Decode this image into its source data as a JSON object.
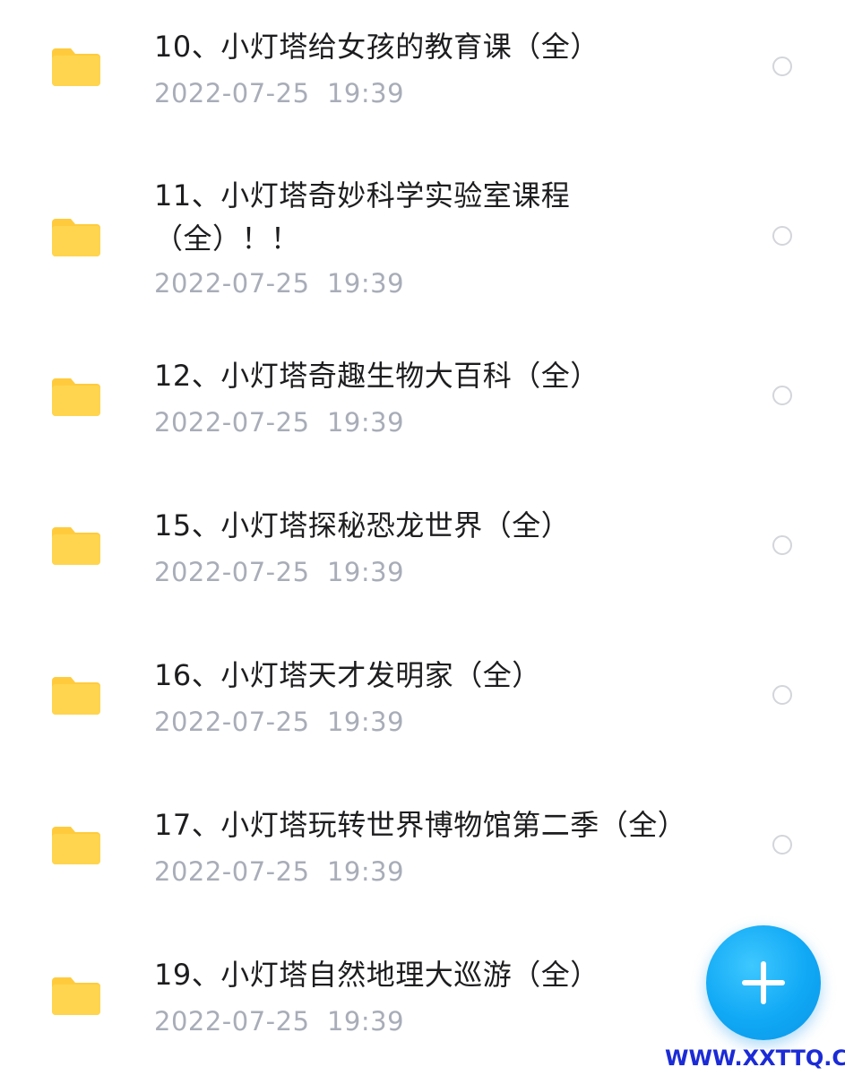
{
  "files": [
    {
      "title": "10、小灯塔给女孩的教育课（全）",
      "date": "2022-07-25  19:39"
    },
    {
      "title": "11、小灯塔奇妙科学实验室课程\n（全）！！",
      "date": "2022-07-25  19:39"
    },
    {
      "title": "12、小灯塔奇趣生物大百科（全）",
      "date": "2022-07-25  19:39"
    },
    {
      "title": "15、小灯塔探秘恐龙世界（全）",
      "date": "2022-07-25  19:39"
    },
    {
      "title": "16、小灯塔天才发明家（全）",
      "date": "2022-07-25  19:39"
    },
    {
      "title": "17、小灯塔玩转世界博物馆第二季（全）",
      "date": "2022-07-25  19:39"
    },
    {
      "title": "19、小灯塔自然地理大巡游（全）",
      "date": "2022-07-25  19:39"
    }
  ],
  "icons": {
    "folder": "folder-icon",
    "select": "radio-circle",
    "fab": "plus-icon"
  },
  "colors": {
    "folder": "#ffd54f",
    "folder_tab": "#ffcb3d",
    "title": "#1d1d1f",
    "date": "#a8adb8",
    "radio_border": "#d3d5da",
    "fab": "#10a8f5",
    "watermark": "#1b2bd6"
  },
  "watermark": "WWW.XXTTQ.COM"
}
